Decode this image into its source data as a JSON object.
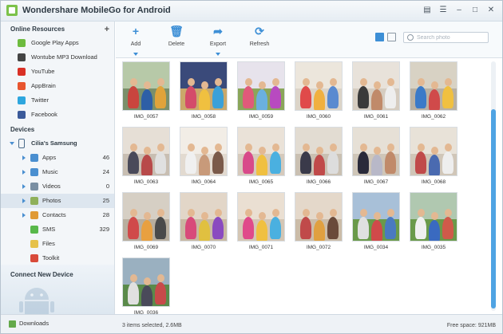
{
  "window": {
    "title": "Wondershare MobileGo for Android"
  },
  "sidebar": {
    "online_header": "Online Resources",
    "resources": [
      {
        "label": "Google Play Apps",
        "icon": "play-store-icon",
        "color": "#6dbb3e"
      },
      {
        "label": "Wontube MP3 Download",
        "icon": "mp3-download-icon",
        "color": "#444"
      },
      {
        "label": "YouTube",
        "icon": "youtube-icon",
        "color": "#d93025"
      },
      {
        "label": "AppBrain",
        "icon": "appbrain-icon",
        "color": "#e8552f"
      },
      {
        "label": "Twitter",
        "icon": "twitter-icon",
        "color": "#2ea6de"
      },
      {
        "label": "Facebook",
        "icon": "facebook-icon",
        "color": "#3b5a9a"
      }
    ],
    "devices_header": "Devices",
    "device_name": "Cilia's Samsung",
    "device_items": [
      {
        "label": "Apps",
        "count": "46",
        "icon": "apps-icon",
        "color": "#4a8fd0",
        "arrow": true
      },
      {
        "label": "Music",
        "count": "24",
        "icon": "music-icon",
        "color": "#4a8fd0",
        "arrow": true
      },
      {
        "label": "Videos",
        "count": "0",
        "icon": "videos-icon",
        "color": "#7a8fa3",
        "arrow": true
      },
      {
        "label": "Photos",
        "count": "25",
        "icon": "photos-icon",
        "color": "#8fb05a",
        "arrow": true
      },
      {
        "label": "Contacts",
        "count": "28",
        "icon": "contacts-icon",
        "color": "#e09a35",
        "arrow": true
      },
      {
        "label": "SMS",
        "count": "329",
        "icon": "sms-icon",
        "color": "#58b84a",
        "arrow": false
      },
      {
        "label": "Files",
        "count": "",
        "icon": "files-icon",
        "color": "#e6c24b",
        "arrow": false
      },
      {
        "label": "Toolkit",
        "count": "",
        "icon": "toolkit-icon",
        "color": "#d84a3a",
        "arrow": false
      }
    ],
    "connect_label": "Connect New Device"
  },
  "toolbar": {
    "add": "Add",
    "delete": "Delete",
    "export": "Export",
    "refresh": "Refresh",
    "search_placeholder": "Search photo"
  },
  "photos": [
    {
      "name": "IMG_0057",
      "sky": "#b7c9a8",
      "floor": "#7a8f6a",
      "pal": [
        "#c9453e",
        "#2e5fa6",
        "#e0a33a"
      ]
    },
    {
      "name": "IMG_0058",
      "sky": "#3a4a7a",
      "floor": "#caa86a",
      "pal": [
        "#d44b6a",
        "#f0c040",
        "#3aa0d8"
      ]
    },
    {
      "name": "IMG_0059",
      "sky": "#e7e3ec",
      "floor": "#8aa65a",
      "pal": [
        "#e05a7a",
        "#6ab0e0",
        "#b84ac0"
      ]
    },
    {
      "name": "IMG_0060",
      "sky": "#ece6dc",
      "floor": "#dcd4c8",
      "pal": [
        "#e04a4a",
        "#f0b040",
        "#5a8ad0"
      ]
    },
    {
      "name": "IMG_0061",
      "sky": "#e8e2da",
      "floor": "#d5ccc0",
      "pal": [
        "#3a3a3a",
        "#c08a6a",
        "#eee"
      ]
    },
    {
      "name": "IMG_0062",
      "sky": "#d8d2c4",
      "floor": "#b8b0a2",
      "pal": [
        "#3a7ac8",
        "#d04a4a",
        "#f0c040"
      ]
    },
    {
      "name": "IMG_0063",
      "sky": "#e6dfd6",
      "floor": "#c8beb2",
      "pal": [
        "#4a4a5a",
        "#b84a4a",
        "#e0e0e0"
      ]
    },
    {
      "name": "IMG_0064",
      "sky": "#f2ede6",
      "floor": "#e2dad0",
      "pal": [
        "#f0f0f0",
        "#c89a7a",
        "#7a5a4a"
      ]
    },
    {
      "name": "IMG_0065",
      "sky": "#eae2d8",
      "floor": "#d6cabc",
      "pal": [
        "#d84a8a",
        "#f0c040",
        "#4ab0e0"
      ]
    },
    {
      "name": "IMG_0066",
      "sky": "#e2dcd2",
      "floor": "#cac0b2",
      "pal": [
        "#3a3a4a",
        "#c04a4a",
        "#ddd"
      ]
    },
    {
      "name": "IMG_0067",
      "sky": "#e6e0d6",
      "floor": "#cfc6b8",
      "pal": [
        "#2a2a3a",
        "#b8b8c8",
        "#c08a6a"
      ]
    },
    {
      "name": "IMG_0068",
      "sky": "#e8e2d8",
      "floor": "#d0c6b8",
      "pal": [
        "#c04a4a",
        "#4a6ab0",
        "#eee"
      ]
    },
    {
      "name": "IMG_0069",
      "sky": "#d6cfc4",
      "floor": "#b8ae9e",
      "pal": [
        "#d04a4a",
        "#e8a040",
        "#4a4a4a"
      ]
    },
    {
      "name": "IMG_0070",
      "sky": "#e2d6c8",
      "floor": "#c8b8a2",
      "pal": [
        "#d84a7a",
        "#e0c040",
        "#8a4ac0"
      ]
    },
    {
      "name": "IMG_0071",
      "sky": "#eadfd2",
      "floor": "#d4c6b4",
      "pal": [
        "#e04a8a",
        "#f0c040",
        "#4ab0e0"
      ]
    },
    {
      "name": "IMG_0072",
      "sky": "#e4d8ca",
      "floor": "#cbbca8",
      "pal": [
        "#c04a4a",
        "#e0a040",
        "#6a4a3a"
      ]
    },
    {
      "name": "IMG_0034",
      "sky": "#a8c0d8",
      "floor": "#6a9a4a",
      "pal": [
        "#e0e0e0",
        "#d04a4a",
        "#4a7ac0"
      ]
    },
    {
      "name": "IMG_0035",
      "sky": "#b0c8b0",
      "floor": "#6a9a4a",
      "pal": [
        "#f0f0f0",
        "#3a6ac0",
        "#d05a4a"
      ]
    },
    {
      "name": "IMG_0036",
      "sky": "#9ab0c0",
      "floor": "#5a8a4a",
      "pal": [
        "#e0e0e0",
        "#4a4a5a",
        "#c84a4a"
      ]
    }
  ],
  "status": {
    "downloads": "Downloads",
    "selection": "3 items selected, 2.6MB",
    "free_space": "Free space: 921MB"
  }
}
